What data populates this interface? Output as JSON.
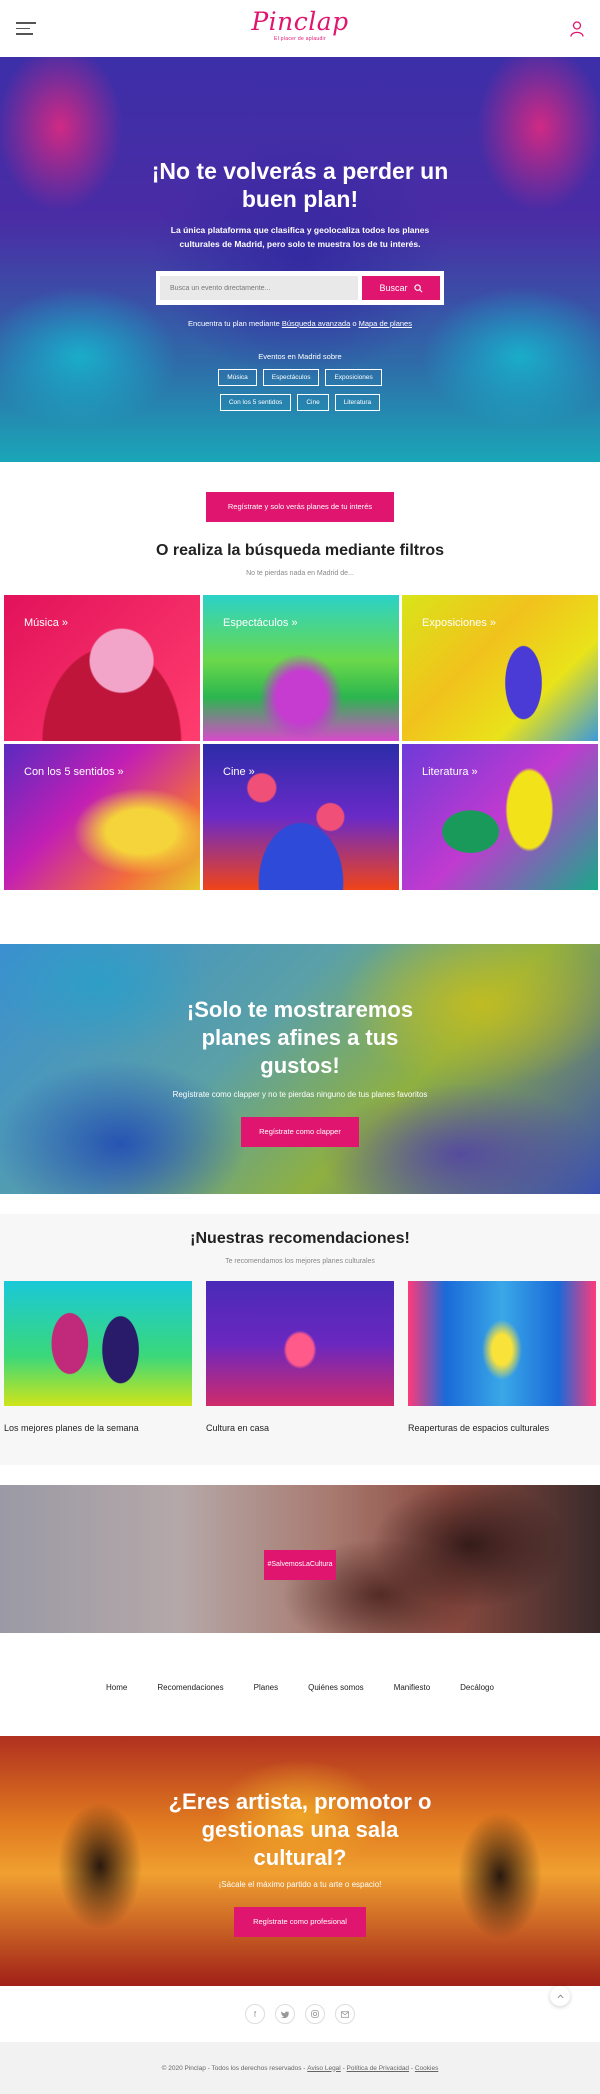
{
  "header": {
    "brand": "Pinclap",
    "tagline": "El placer de aplaudir",
    "menu_icon": "menu-icon",
    "user_icon": "user-icon"
  },
  "hero": {
    "title": "¡No te volverás a perder un buen plan!",
    "subtitle": "La única plataforma que clasifica y geolocaliza todos los planes culturales de Madrid, pero solo te muestra los de tu interés.",
    "search_placeholder": "Busca un evento directamente...",
    "search_button": "Buscar",
    "find_prefix": "Encuentra tu plan mediante",
    "advanced_link": "Búsqueda avanzada",
    "find_or": "o",
    "map_link": "Mapa de planes",
    "events_label": "Eventos en Madrid sobre",
    "chips_row1": [
      "Música",
      "Espectáculos",
      "Exposiciones"
    ],
    "chips_row2": [
      "Con los 5 sentidos",
      "Cine",
      "Literatura"
    ]
  },
  "register_cta": "Regístrate y solo verás planes de tu interés",
  "filters": {
    "title": "O realiza la búsqueda mediante filtros",
    "subtitle": "No te pierdas nada en Madrid de...",
    "tiles": [
      "Música »",
      "Espectáculos »",
      "Exposiciones »",
      "Con los 5 sentidos »",
      "Cine »",
      "Literatura »"
    ]
  },
  "promo": {
    "title": "¡Solo te mostraremos planes afines a tus gustos!",
    "subtitle": "Regístrate como clapper y no te pierdas ninguno de tus planes favoritos",
    "button": "Regístrate como clapper"
  },
  "recs": {
    "title": "¡Nuestras recomendaciones!",
    "subtitle": "Te recomendamos los mejores planes culturales",
    "items": [
      "Los mejores planes de la semana",
      "Cultura en casa",
      "Reaperturas de espacios culturales"
    ]
  },
  "heart_button": "#SalvemosLaCultura",
  "footer_nav": [
    "Home",
    "Recomendaciones",
    "Planes",
    "Quiénes somos",
    "Manifiesto",
    "Decálogo"
  ],
  "artist": {
    "title": "¿Eres artista, promotor o gestionas una sala cultural?",
    "subtitle": "¡Sácale el máximo partido a tu arte o espacio!",
    "button": "Regístrate como profesional"
  },
  "social": [
    "facebook-icon",
    "twitter-icon",
    "instagram-icon",
    "email-icon"
  ],
  "copyright": {
    "text": "© 2020 Pinclap - Todos los derechos reservados -",
    "legal": "Aviso Legal",
    "privacy": "Política de Privacidad",
    "cookies": "Cookies",
    "sep": "-"
  },
  "colors": {
    "accent": "#e0156f"
  }
}
